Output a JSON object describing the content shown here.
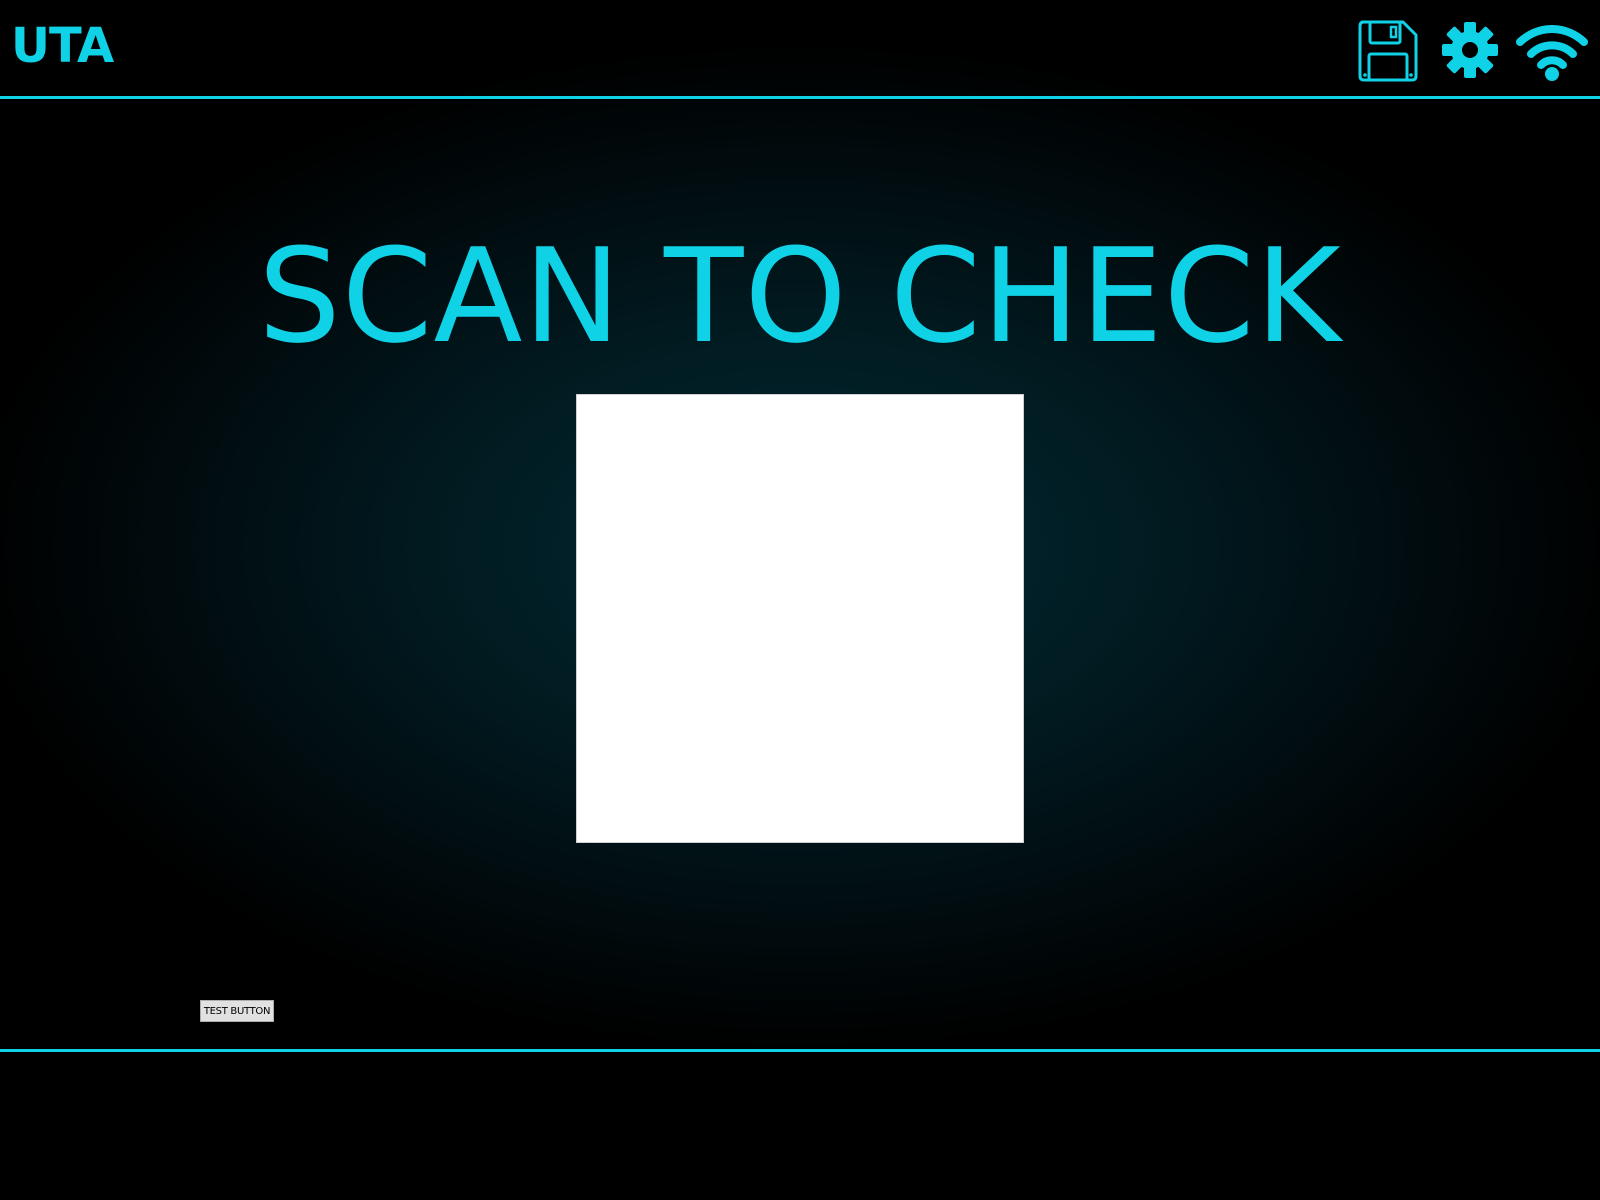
{
  "header": {
    "logo_text": "UTA",
    "icons": [
      "save-icon",
      "gear-icon",
      "wifi-icon"
    ]
  },
  "main": {
    "headline": "SCAN TO CHECK",
    "test_button_label": "TEST BUTTON"
  },
  "colors": {
    "accent": "#0fd2e6",
    "background": "#000000",
    "panel": "#ffffff"
  }
}
